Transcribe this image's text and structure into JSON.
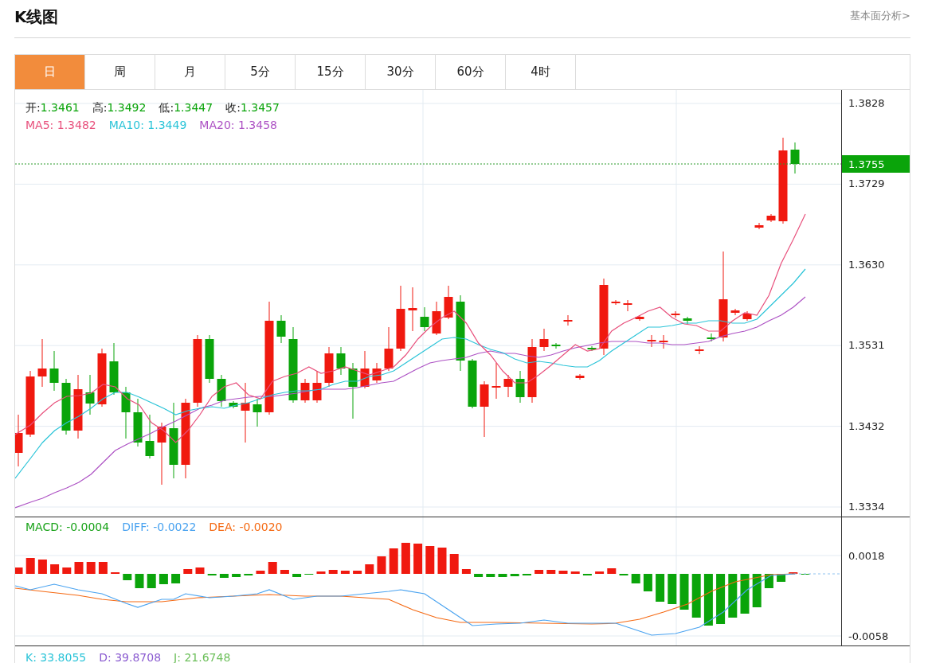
{
  "header": {
    "title": "K线图",
    "link": "基本面分析>"
  },
  "tabs": [
    {
      "label": "日",
      "selected": true
    },
    {
      "label": "周",
      "selected": false
    },
    {
      "label": "月",
      "selected": false
    },
    {
      "label": "5分",
      "selected": false
    },
    {
      "label": "15分",
      "selected": false
    },
    {
      "label": "30分",
      "selected": false
    },
    {
      "label": "60分",
      "selected": false
    },
    {
      "label": "4时",
      "selected": false
    }
  ],
  "main_panel": {
    "ohlc": [
      {
        "label": "开:",
        "value": "1.3461"
      },
      {
        "label": "高:",
        "value": "1.3492"
      },
      {
        "label": "低:",
        "value": "1.3447"
      },
      {
        "label": "收:",
        "value": "1.3457"
      }
    ],
    "moving_averages": [
      {
        "text": "MA5: 1.3482",
        "color": "#e8507c"
      },
      {
        "text": "MA10: 1.3449",
        "color": "#2bc4d8"
      },
      {
        "text": "MA20: 1.3458",
        "color": "#ad52c4"
      }
    ],
    "price_ticks": [
      "1.3828",
      "1.3729",
      "1.3630",
      "1.3531",
      "1.3432",
      "1.3334"
    ],
    "current_price": "1.3755"
  },
  "macd_panel": {
    "legend": [
      {
        "text": "MACD: -0.0004",
        "color": "#1aa31a"
      },
      {
        "text": "DIFF: -0.0022",
        "color": "#4aa3f0"
      },
      {
        "text": "DEA: -0.0020",
        "color": "#f56a14"
      }
    ],
    "ticks": [
      "0.0018",
      "-0.0058"
    ]
  },
  "kdj_panel": {
    "legend": [
      {
        "text": "K: 33.8055",
        "color": "#2bc4d8"
      },
      {
        "text": "D: 39.8708",
        "color": "#8a5bd0"
      },
      {
        "text": "J: 21.6748",
        "color": "#6cbf5a"
      }
    ]
  }
}
